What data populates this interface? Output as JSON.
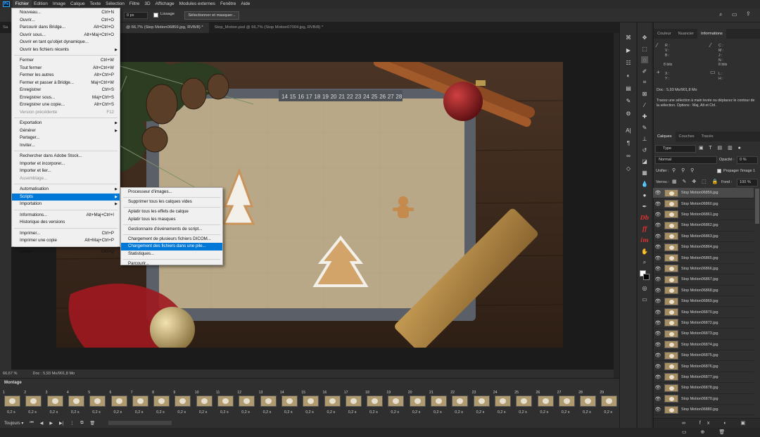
{
  "menubar": {
    "items": [
      "Fichier",
      "Edition",
      "Image",
      "Calque",
      "Texte",
      "Sélection",
      "Filtre",
      "3D",
      "Affichage",
      "Modules externes",
      "Fenêtre",
      "Aide"
    ]
  },
  "options": {
    "lissage_label": "Lissage",
    "select_mask_label": "Sélectionner et masquer...",
    "px_value": "0 px"
  },
  "doc_tabs": [
    "Sa",
    "@ 66,7% (Stop Motion06859.jpg, RVB/8) *",
    "Stop_Motion.psd @ 66,7% (Stop Motion07004.jpg, RVB/8) *"
  ],
  "file_menu": [
    {
      "label": "Nouveau...",
      "shortcut": "Ctrl+N"
    },
    {
      "label": "Ouvrir...",
      "shortcut": "Ctrl+O"
    },
    {
      "label": "Parcourir dans Bridge...",
      "shortcut": "Alt+Ctrl+O"
    },
    {
      "label": "Ouvrir sous...",
      "shortcut": "Alt+Maj+Ctrl+O"
    },
    {
      "label": "Ouvrir en tant qu'objet dynamique...",
      "shortcut": ""
    },
    {
      "label": "Ouvrir les fichiers récents",
      "shortcut": "",
      "submenu": true
    },
    {
      "sep": true
    },
    {
      "label": "Fermer",
      "shortcut": "Ctrl+W"
    },
    {
      "label": "Tout fermer",
      "shortcut": "Alt+Ctrl+W"
    },
    {
      "label": "Fermer les autres",
      "shortcut": "Alt+Ctrl+P"
    },
    {
      "label": "Fermer et passer à Bridge...",
      "shortcut": "Maj+Ctrl+W"
    },
    {
      "label": "Enregistrer",
      "shortcut": "Ctrl+S"
    },
    {
      "label": "Enregistrer sous...",
      "shortcut": "Maj+Ctrl+S"
    },
    {
      "label": "Enregistrer une copie...",
      "shortcut": "Alt+Ctrl+S"
    },
    {
      "label": "Version précédente",
      "shortcut": "F12",
      "disabled": true
    },
    {
      "sep": true
    },
    {
      "label": "Exportation",
      "shortcut": "",
      "submenu": true
    },
    {
      "label": "Générer",
      "shortcut": "",
      "submenu": true
    },
    {
      "label": "Partager...",
      "shortcut": ""
    },
    {
      "label": "Inviter...",
      "shortcut": ""
    },
    {
      "sep": true
    },
    {
      "label": "Rechercher dans Adobe Stock...",
      "shortcut": ""
    },
    {
      "label": "Importer et incorporer...",
      "shortcut": ""
    },
    {
      "label": "Importer et lier...",
      "shortcut": ""
    },
    {
      "label": "Assemblage...",
      "shortcut": "",
      "disabled": true
    },
    {
      "sep": true
    },
    {
      "label": "Automatisation",
      "shortcut": "",
      "submenu": true
    },
    {
      "label": "Scripts",
      "shortcut": "",
      "submenu": true,
      "highlighted": true
    },
    {
      "label": "Importation",
      "shortcut": "",
      "submenu": true
    },
    {
      "sep": true
    },
    {
      "label": "Informations...",
      "shortcut": "Alt+Maj+Ctrl+I"
    },
    {
      "label": "Historique des versions",
      "shortcut": ""
    },
    {
      "sep": true
    },
    {
      "label": "Imprimer...",
      "shortcut": "Ctrl+P"
    },
    {
      "label": "Imprimer une copie",
      "shortcut": "Alt+Maj+Ctrl+P"
    },
    {
      "sep": true
    },
    {
      "label": "Quitter",
      "shortcut": "Ctrl+Q"
    }
  ],
  "scripts_menu": [
    {
      "label": "Processeur d'images..."
    },
    {
      "sep": true
    },
    {
      "label": "Supprimer tous les calques vides"
    },
    {
      "sep": true
    },
    {
      "label": "Aplatir tous les effets de calque"
    },
    {
      "label": "Aplatir tous les masques"
    },
    {
      "sep": true
    },
    {
      "label": "Gestionnaire d'événements de script..."
    },
    {
      "sep": true
    },
    {
      "label": "Chargement de plusieurs fichiers DICOM..."
    },
    {
      "label": "Chargement des fichiers dans une pile...",
      "highlighted": true
    },
    {
      "label": "Statistiques..."
    },
    {
      "sep": true
    },
    {
      "label": "Parcourir..."
    }
  ],
  "ruler_numbers": [
    "14",
    "15",
    "16",
    "17",
    "18",
    "19",
    "20",
    "21",
    "22",
    "23",
    "24",
    "25",
    "26",
    "27",
    "28"
  ],
  "status": {
    "zoom": "66,67 %",
    "doc": "Doc : 5,93 Mo/901,8 Mo"
  },
  "timeline": {
    "title": "Montage",
    "frames": [
      "1",
      "2",
      "3",
      "4",
      "5",
      "6",
      "7",
      "8",
      "9",
      "10",
      "11",
      "12",
      "13",
      "14",
      "15",
      "16",
      "17",
      "18",
      "19",
      "20",
      "21",
      "22",
      "23",
      "24",
      "25",
      "26",
      "27",
      "28",
      "29"
    ],
    "duration": "0,2 s",
    "loop": "Toujours"
  },
  "panel_top": {
    "tabs": [
      "Couleur",
      "Nuancier",
      "Informations"
    ],
    "info_bits_left": "8 bits",
    "info_bits_right": "8 bits",
    "doc": "Doc : 5,93 Mo/901,8 Mo",
    "hint": "Tracez une sélection à main levée ou déplacez le contour de la sélection. Options : Maj, Alt et Ctrl.",
    "labels_left": [
      "R :",
      "V :",
      "B :"
    ],
    "labels_right": [
      "C :",
      "M :",
      "J :",
      "N :"
    ],
    "xy_left": [
      "X :",
      "Y :"
    ],
    "xy_right": [
      "L :",
      "H :"
    ]
  },
  "layers_panel": {
    "tabs": [
      "Calques",
      "Couches",
      "Tracés"
    ],
    "filter": "Type",
    "blend": "Normal",
    "opacity_label": "Opacité :",
    "opacity": "0 %",
    "unify_label": "Unifier :",
    "propagate": "Propager l'image 1",
    "lock_label": "Verrou :",
    "fill_label": "Fond :",
    "fill": "100 %",
    "layers": [
      "Stop Motion06859.jpg",
      "Stop Motion06860.jpg",
      "Stop Motion06861.jpg",
      "Stop Motion06862.jpg",
      "Stop Motion06863.jpg",
      "Stop Motion06864.jpg",
      "Stop Motion06865.jpg",
      "Stop Motion06866.jpg",
      "Stop Motion06867.jpg",
      "Stop Motion06868.jpg",
      "Stop Motion06869.jpg",
      "Stop Motion06870.jpg",
      "Stop Motion06872.jpg",
      "Stop Motion06873.jpg",
      "Stop Motion06874.jpg",
      "Stop Motion06875.jpg",
      "Stop Motion06876.jpg",
      "Stop Motion06877.jpg",
      "Stop Motion06878.jpg",
      "Stop Motion06879.jpg",
      "Stop Motion06880.jpg"
    ]
  },
  "plugin_icons": {
    "db": "Db",
    "ff": "ff",
    "im": "im"
  }
}
